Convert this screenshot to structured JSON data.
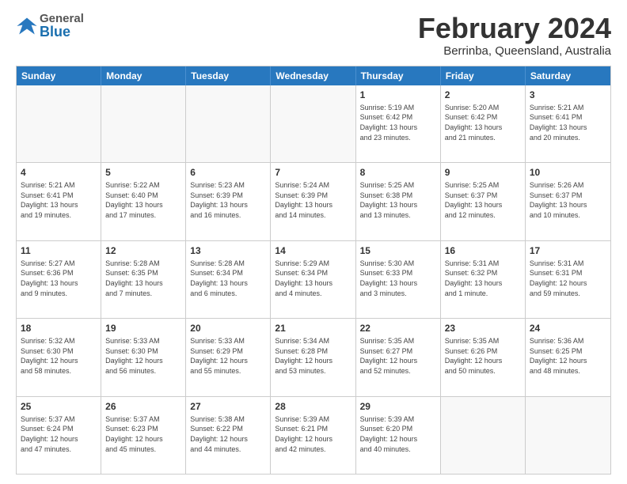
{
  "header": {
    "logo": {
      "general": "General",
      "blue": "Blue"
    },
    "month": "February 2024",
    "location": "Berrinba, Queensland, Australia"
  },
  "calendar": {
    "days": [
      "Sunday",
      "Monday",
      "Tuesday",
      "Wednesday",
      "Thursday",
      "Friday",
      "Saturday"
    ],
    "rows": [
      [
        {
          "day": "",
          "info": ""
        },
        {
          "day": "",
          "info": ""
        },
        {
          "day": "",
          "info": ""
        },
        {
          "day": "",
          "info": ""
        },
        {
          "day": "1",
          "info": "Sunrise: 5:19 AM\nSunset: 6:42 PM\nDaylight: 13 hours\nand 23 minutes."
        },
        {
          "day": "2",
          "info": "Sunrise: 5:20 AM\nSunset: 6:42 PM\nDaylight: 13 hours\nand 21 minutes."
        },
        {
          "day": "3",
          "info": "Sunrise: 5:21 AM\nSunset: 6:41 PM\nDaylight: 13 hours\nand 20 minutes."
        }
      ],
      [
        {
          "day": "4",
          "info": "Sunrise: 5:21 AM\nSunset: 6:41 PM\nDaylight: 13 hours\nand 19 minutes."
        },
        {
          "day": "5",
          "info": "Sunrise: 5:22 AM\nSunset: 6:40 PM\nDaylight: 13 hours\nand 17 minutes."
        },
        {
          "day": "6",
          "info": "Sunrise: 5:23 AM\nSunset: 6:39 PM\nDaylight: 13 hours\nand 16 minutes."
        },
        {
          "day": "7",
          "info": "Sunrise: 5:24 AM\nSunset: 6:39 PM\nDaylight: 13 hours\nand 14 minutes."
        },
        {
          "day": "8",
          "info": "Sunrise: 5:25 AM\nSunset: 6:38 PM\nDaylight: 13 hours\nand 13 minutes."
        },
        {
          "day": "9",
          "info": "Sunrise: 5:25 AM\nSunset: 6:37 PM\nDaylight: 13 hours\nand 12 minutes."
        },
        {
          "day": "10",
          "info": "Sunrise: 5:26 AM\nSunset: 6:37 PM\nDaylight: 13 hours\nand 10 minutes."
        }
      ],
      [
        {
          "day": "11",
          "info": "Sunrise: 5:27 AM\nSunset: 6:36 PM\nDaylight: 13 hours\nand 9 minutes."
        },
        {
          "day": "12",
          "info": "Sunrise: 5:28 AM\nSunset: 6:35 PM\nDaylight: 13 hours\nand 7 minutes."
        },
        {
          "day": "13",
          "info": "Sunrise: 5:28 AM\nSunset: 6:34 PM\nDaylight: 13 hours\nand 6 minutes."
        },
        {
          "day": "14",
          "info": "Sunrise: 5:29 AM\nSunset: 6:34 PM\nDaylight: 13 hours\nand 4 minutes."
        },
        {
          "day": "15",
          "info": "Sunrise: 5:30 AM\nSunset: 6:33 PM\nDaylight: 13 hours\nand 3 minutes."
        },
        {
          "day": "16",
          "info": "Sunrise: 5:31 AM\nSunset: 6:32 PM\nDaylight: 13 hours\nand 1 minute."
        },
        {
          "day": "17",
          "info": "Sunrise: 5:31 AM\nSunset: 6:31 PM\nDaylight: 12 hours\nand 59 minutes."
        }
      ],
      [
        {
          "day": "18",
          "info": "Sunrise: 5:32 AM\nSunset: 6:30 PM\nDaylight: 12 hours\nand 58 minutes."
        },
        {
          "day": "19",
          "info": "Sunrise: 5:33 AM\nSunset: 6:30 PM\nDaylight: 12 hours\nand 56 minutes."
        },
        {
          "day": "20",
          "info": "Sunrise: 5:33 AM\nSunset: 6:29 PM\nDaylight: 12 hours\nand 55 minutes."
        },
        {
          "day": "21",
          "info": "Sunrise: 5:34 AM\nSunset: 6:28 PM\nDaylight: 12 hours\nand 53 minutes."
        },
        {
          "day": "22",
          "info": "Sunrise: 5:35 AM\nSunset: 6:27 PM\nDaylight: 12 hours\nand 52 minutes."
        },
        {
          "day": "23",
          "info": "Sunrise: 5:35 AM\nSunset: 6:26 PM\nDaylight: 12 hours\nand 50 minutes."
        },
        {
          "day": "24",
          "info": "Sunrise: 5:36 AM\nSunset: 6:25 PM\nDaylight: 12 hours\nand 48 minutes."
        }
      ],
      [
        {
          "day": "25",
          "info": "Sunrise: 5:37 AM\nSunset: 6:24 PM\nDaylight: 12 hours\nand 47 minutes."
        },
        {
          "day": "26",
          "info": "Sunrise: 5:37 AM\nSunset: 6:23 PM\nDaylight: 12 hours\nand 45 minutes."
        },
        {
          "day": "27",
          "info": "Sunrise: 5:38 AM\nSunset: 6:22 PM\nDaylight: 12 hours\nand 44 minutes."
        },
        {
          "day": "28",
          "info": "Sunrise: 5:39 AM\nSunset: 6:21 PM\nDaylight: 12 hours\nand 42 minutes."
        },
        {
          "day": "29",
          "info": "Sunrise: 5:39 AM\nSunset: 6:20 PM\nDaylight: 12 hours\nand 40 minutes."
        },
        {
          "day": "",
          "info": ""
        },
        {
          "day": "",
          "info": ""
        }
      ]
    ]
  }
}
